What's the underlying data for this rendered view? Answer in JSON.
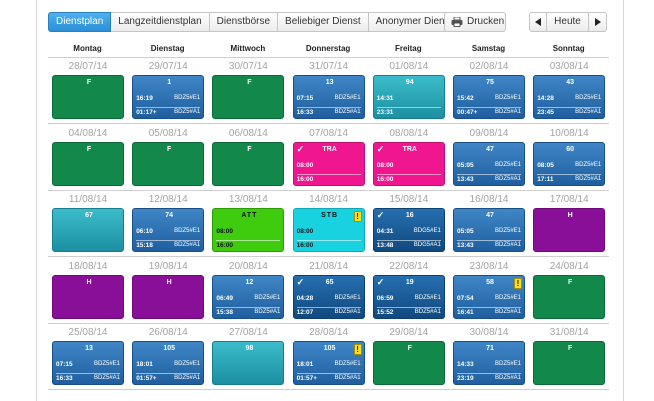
{
  "tabs": [
    "Dienstplan",
    "Langzeitdienstplan",
    "Dienstbörse",
    "Beliebiger Dienst",
    "Anonymer Dienst"
  ],
  "active_tab": "Dienstplan",
  "print_label": "Drucken",
  "today_label": "Heute",
  "weekdays": [
    "Montag",
    "Dienstag",
    "Mittwoch",
    "Donnerstag",
    "Freitag",
    "Samstag",
    "Sonntag"
  ],
  "colors": {
    "active_tab": "#2a8fd6",
    "free_day": "#12894b",
    "regular_shift": "#2f73b5",
    "teal_shift": "#2aa5b6",
    "training": "#f0168f",
    "vacation": "#8a0f98",
    "att": "#3fcc0e",
    "stb": "#18d3df",
    "warning": "#f7e11e"
  },
  "weeks": [
    [
      {
        "date": "28/07/14",
        "label": "F",
        "style": "green"
      },
      {
        "date": "29/07/14",
        "label": "1",
        "style": "blue",
        "start": "16:19",
        "start_code": "BDZ5#E1",
        "end": "01:17+",
        "end_code": "BDZ5#A1"
      },
      {
        "date": "30/07/14",
        "label": "F",
        "style": "green"
      },
      {
        "date": "31/07/14",
        "label": "13",
        "style": "blue",
        "start": "07:15",
        "start_code": "BDZ5#E1",
        "end": "16:33",
        "end_code": "BDZ5#A1"
      },
      {
        "date": "01/08/14",
        "label": "94",
        "style": "teal",
        "start": "14:31",
        "end": "23:31"
      },
      {
        "date": "02/08/14",
        "label": "75",
        "style": "blue",
        "start": "15:42",
        "start_code": "BDZ5#E1",
        "end": "00:47+",
        "end_code": "BDZ5#A1"
      },
      {
        "date": "03/08/14",
        "label": "43",
        "style": "blue",
        "start": "14:28",
        "start_code": "BDZ5#E1",
        "end": "23:45",
        "end_code": "BDZ5#A1"
      }
    ],
    [
      {
        "date": "04/08/14",
        "label": "F",
        "style": "green"
      },
      {
        "date": "05/08/14",
        "label": "F",
        "style": "green"
      },
      {
        "date": "06/08/14",
        "label": "F",
        "style": "green"
      },
      {
        "date": "07/08/14",
        "label": "TRA",
        "style": "pink",
        "check": true,
        "start": "08:00",
        "end": "16:00"
      },
      {
        "date": "08/08/14",
        "label": "TRA",
        "style": "pink",
        "check": true,
        "start": "08:00",
        "end": "16:00"
      },
      {
        "date": "09/08/14",
        "label": "47",
        "style": "blue",
        "start": "05:05",
        "start_code": "BDZ5#E1",
        "end": "13:43",
        "end_code": "BDZ5#A1"
      },
      {
        "date": "10/08/14",
        "label": "60",
        "style": "blue",
        "start": "08:05",
        "start_code": "BDZ5#E1",
        "end": "17:11",
        "end_code": "BDZ5#A1"
      }
    ],
    [
      {
        "date": "11/08/14",
        "label": "67",
        "style": "teal"
      },
      {
        "date": "12/08/14",
        "label": "74",
        "style": "blue",
        "start": "06:10",
        "start_code": "BDZ5#E1",
        "end": "15:18",
        "end_code": "BDZ5#A1"
      },
      {
        "date": "13/08/14",
        "label": "ATT",
        "style": "lime",
        "start": "08:00",
        "end": "16:00"
      },
      {
        "date": "14/08/14",
        "label": "STB",
        "style": "cyan",
        "warn": true,
        "start": "08:00",
        "end": "16:00"
      },
      {
        "date": "15/08/14",
        "label": "16",
        "style": "navy",
        "check": true,
        "start": "04:31",
        "start_code": "BDG5#E1",
        "end": "13:48",
        "end_code": "BDG5#A1"
      },
      {
        "date": "16/08/14",
        "label": "47",
        "style": "blue",
        "start": "05:05",
        "start_code": "BDZ5#E1",
        "end": "13:43",
        "end_code": "BDZ5#A1"
      },
      {
        "date": "17/08/14",
        "label": "H",
        "style": "purple"
      }
    ],
    [
      {
        "date": "18/08/14",
        "label": "H",
        "style": "purple"
      },
      {
        "date": "19/08/14",
        "label": "H",
        "style": "purple"
      },
      {
        "date": "20/08/14",
        "label": "12",
        "style": "blue",
        "start": "06:49",
        "start_code": "BDZ5#E1",
        "end": "15:38",
        "end_code": "BDZ5#A1"
      },
      {
        "date": "21/08/14",
        "label": "65",
        "style": "navy",
        "check": true,
        "start": "04:28",
        "start_code": "BDZ5#E1",
        "end": "12:07",
        "end_code": "BDZ5#A1"
      },
      {
        "date": "22/08/14",
        "label": "19",
        "style": "navy",
        "check": true,
        "start": "06:59",
        "start_code": "BDZ5#E1",
        "end": "15:52",
        "end_code": "BDZ5#A1"
      },
      {
        "date": "23/08/14",
        "label": "58",
        "style": "blue",
        "warn": true,
        "start": "07:54",
        "start_code": "BDZ5#E1",
        "end": "16:41",
        "end_code": "BDZ5#A1"
      },
      {
        "date": "24/08/14",
        "label": "F",
        "style": "green"
      }
    ],
    [
      {
        "date": "25/08/14",
        "label": "13",
        "style": "blue",
        "start": "07:15",
        "start_code": "BDZ5#E1",
        "end": "16:33",
        "end_code": "BDZ5#A1"
      },
      {
        "date": "26/08/14",
        "label": "105",
        "style": "blue",
        "start": "18:01",
        "start_code": "BDZ5#E1",
        "end": "01:57+",
        "end_code": "BDZ5#A1"
      },
      {
        "date": "27/08/14",
        "label": "98",
        "style": "teal"
      },
      {
        "date": "28/08/14",
        "label": "105",
        "style": "blue",
        "warn": true,
        "start": "18:01",
        "start_code": "BDZ5#E1",
        "end": "01:57+",
        "end_code": "BDZ5#A1"
      },
      {
        "date": "29/08/14",
        "label": "F",
        "style": "green"
      },
      {
        "date": "30/08/14",
        "label": "71",
        "style": "blue",
        "start": "14:33",
        "start_code": "BDZ5#E1",
        "end": "23:19",
        "end_code": "BDZ5#A1"
      },
      {
        "date": "31/08/14",
        "label": "F",
        "style": "green"
      }
    ]
  ]
}
